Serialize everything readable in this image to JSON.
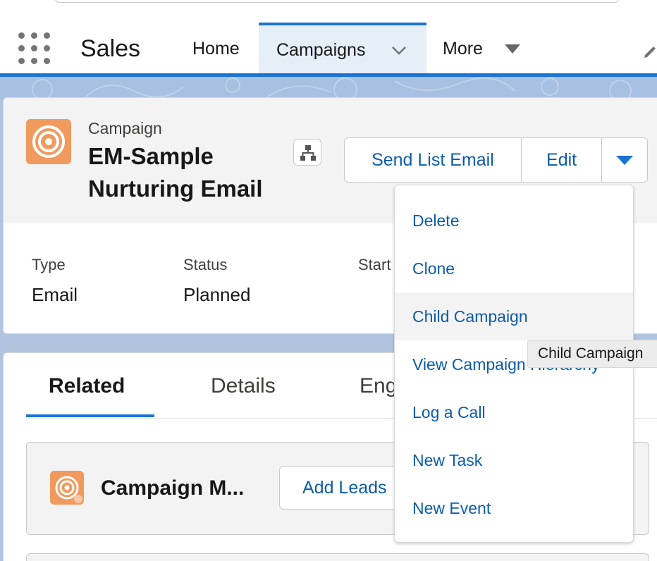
{
  "nav": {
    "app_name": "Sales",
    "tabs": [
      {
        "label": "Home"
      },
      {
        "label": "Campaigns"
      },
      {
        "label": "More"
      }
    ]
  },
  "record": {
    "object_label": "Campaign",
    "name": "EM-Sample Nurturing Email",
    "icon": "campaign-target-icon",
    "icon_color": "#f09a5d"
  },
  "actions": {
    "send_list_email": "Send List Email",
    "edit": "Edit"
  },
  "fields": [
    {
      "label": "Type",
      "value": "Email"
    },
    {
      "label": "Status",
      "value": "Planned"
    },
    {
      "label": "Start",
      "value": ""
    }
  ],
  "related_tabs": [
    {
      "label": "Related"
    },
    {
      "label": "Details"
    },
    {
      "label": "Eng"
    }
  ],
  "related_list": {
    "title": "Campaign M...",
    "add_button": "Add Leads"
  },
  "dropdown_menu": {
    "items": [
      {
        "label": "Delete"
      },
      {
        "label": "Clone"
      },
      {
        "label": "Child Campaign"
      },
      {
        "label": "View Campaign Hierarchy"
      },
      {
        "label": "Log a Call"
      },
      {
        "label": "New Task"
      },
      {
        "label": "New Event"
      }
    ],
    "hovered_item": "Child Campaign"
  },
  "tooltip": {
    "text": "Child Campaign"
  },
  "colors": {
    "brand_blue": "#1b74d4",
    "link_blue": "#0b5cab",
    "campaign_orange": "#f09a5d",
    "active_tab_bg": "#e6eef8"
  }
}
